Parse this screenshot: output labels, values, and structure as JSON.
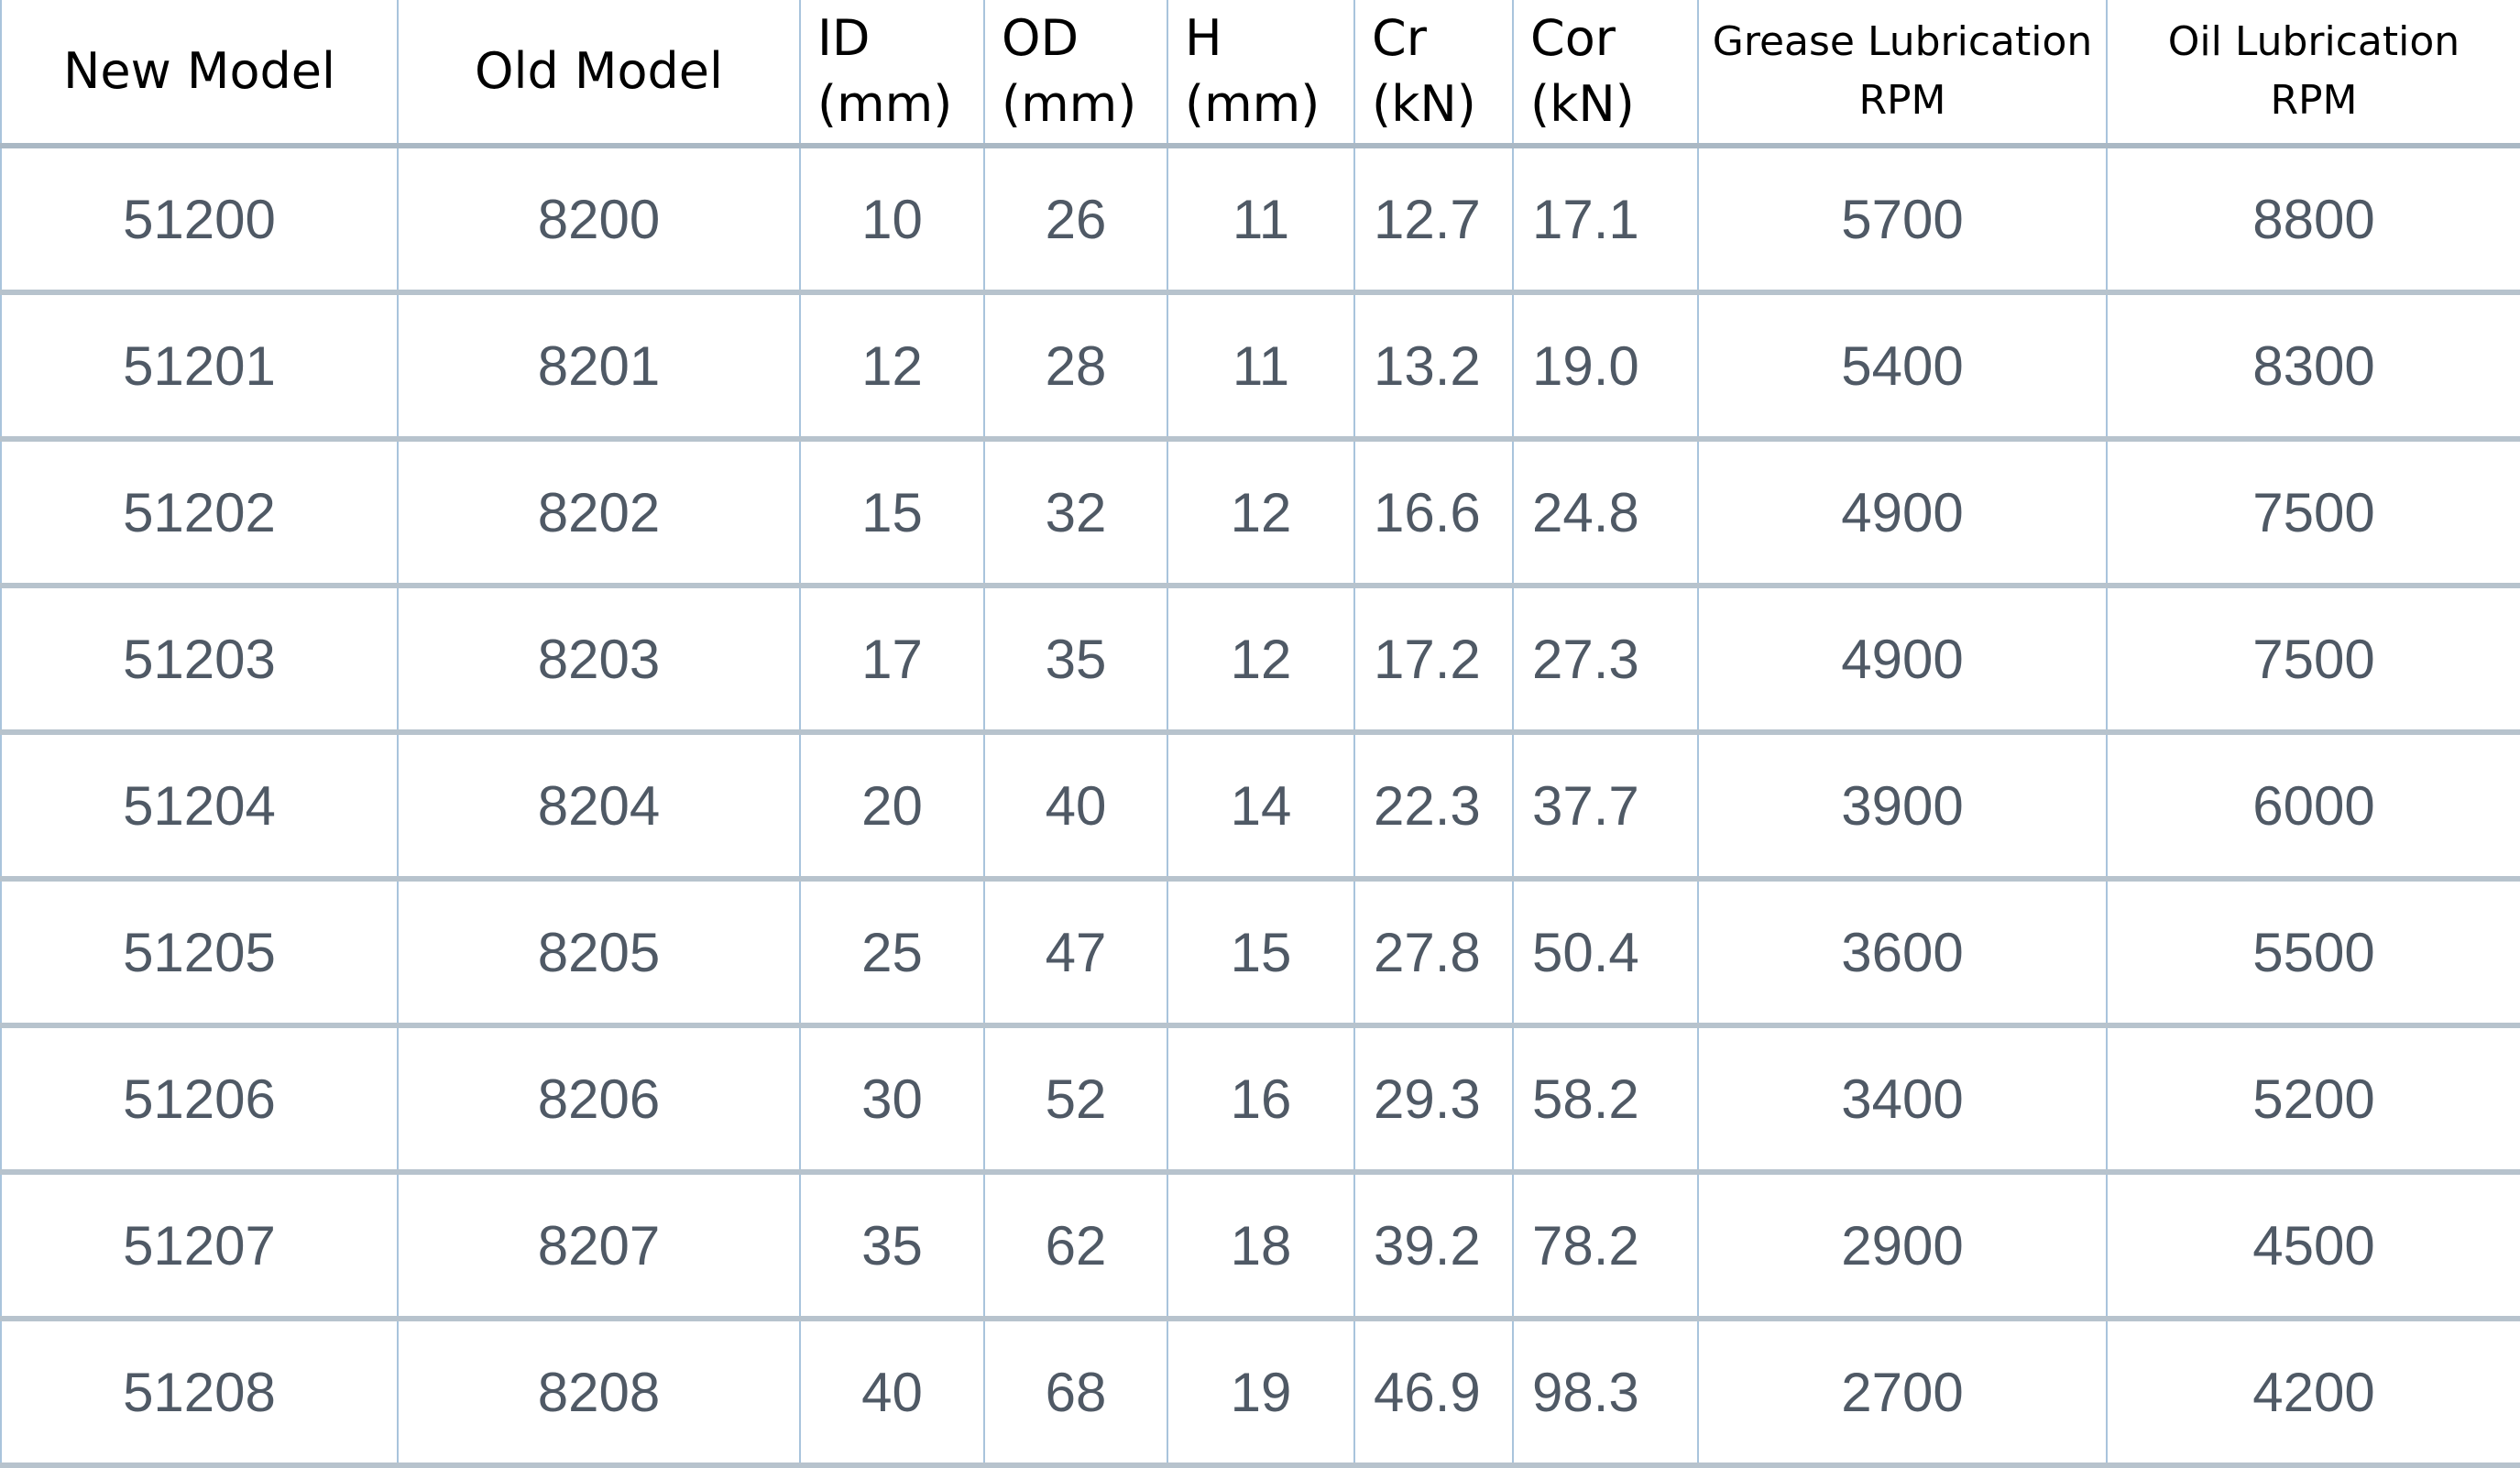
{
  "table": {
    "headers": [
      "New Model",
      "Old Model",
      "ID\n(mm)",
      "OD\n(mm)",
      "H\n(mm)",
      "Cr\n(kN)",
      "Cor\n(kN)",
      "Grease Lubrication\nRPM",
      "Oil Lubrication\nRPM"
    ],
    "rows": [
      [
        "51200",
        "8200",
        "10",
        "26",
        "11",
        "12.7",
        "17.1",
        "5700",
        "8800"
      ],
      [
        "51201",
        "8201",
        "12",
        "28",
        "11",
        "13.2",
        "19.0",
        "5400",
        "8300"
      ],
      [
        "51202",
        "8202",
        "15",
        "32",
        "12",
        "16.6",
        "24.8",
        "4900",
        "7500"
      ],
      [
        "51203",
        "8203",
        "17",
        "35",
        "12",
        "17.2",
        "27.3",
        "4900",
        "7500"
      ],
      [
        "51204",
        "8204",
        "20",
        "40",
        "14",
        "22.3",
        "37.7",
        "3900",
        "6000"
      ],
      [
        "51205",
        "8205",
        "25",
        "47",
        "15",
        "27.8",
        "50.4",
        "3600",
        "5500"
      ],
      [
        "51206",
        "8206",
        "30",
        "52",
        "16",
        "29.3",
        "58.2",
        "3400",
        "5200"
      ],
      [
        "51207",
        "8207",
        "35",
        "62",
        "18",
        "39.2",
        "78.2",
        "2900",
        "4500"
      ],
      [
        "51208",
        "8208",
        "40",
        "68",
        "19",
        "46.9",
        "98.3",
        "2700",
        "4200"
      ]
    ]
  }
}
